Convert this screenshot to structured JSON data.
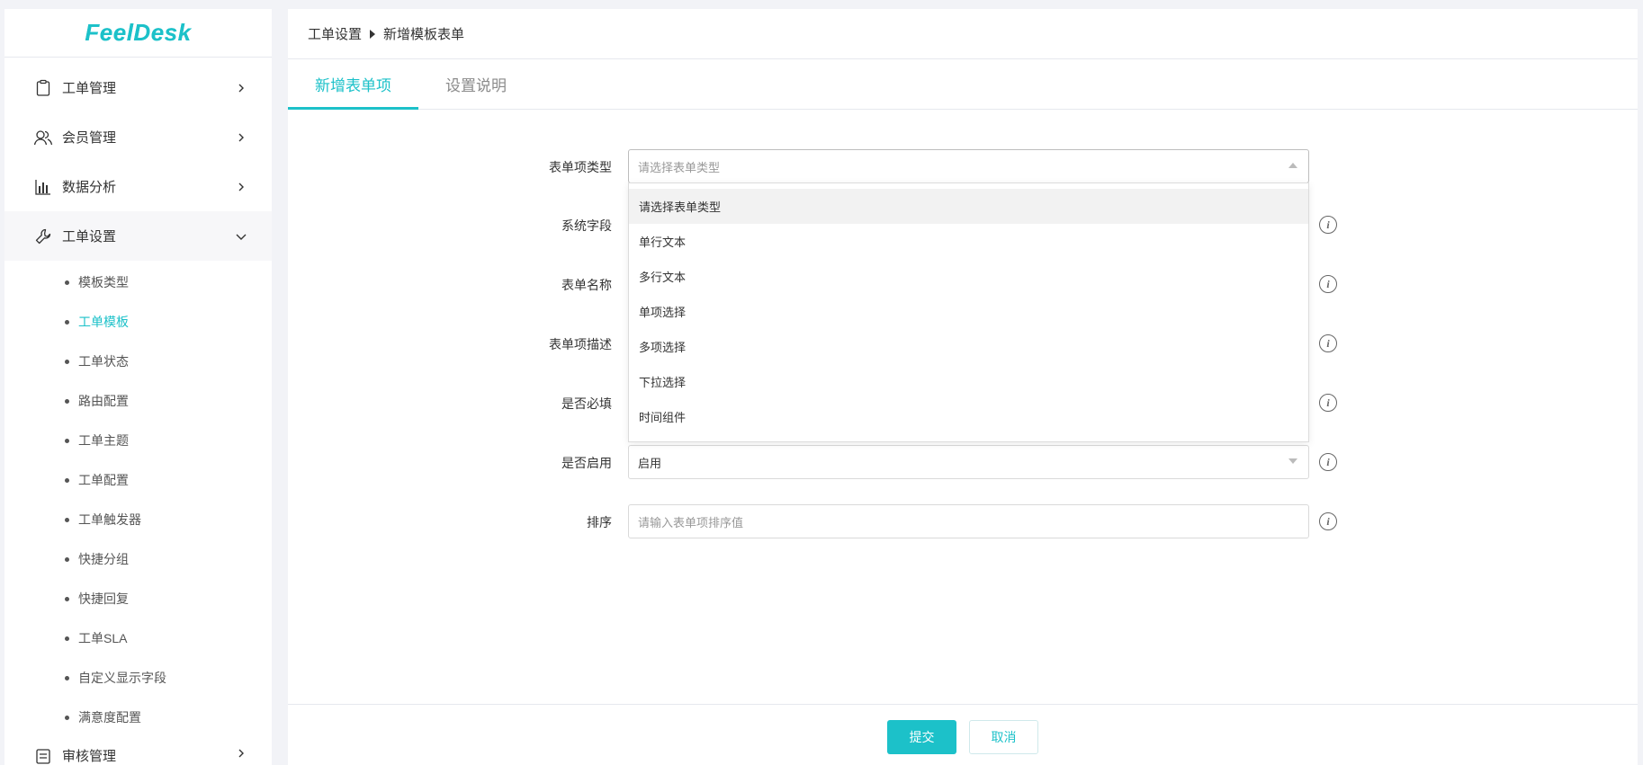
{
  "brand": {
    "logo_text": "FeelDesk",
    "accent": "#1cc1c9"
  },
  "sidebar": {
    "items": [
      {
        "label": "工单管理",
        "icon": "clipboard-icon",
        "expanded": false
      },
      {
        "label": "会员管理",
        "icon": "users-icon",
        "expanded": false
      },
      {
        "label": "数据分析",
        "icon": "bar-chart-icon",
        "expanded": false
      },
      {
        "label": "工单设置",
        "icon": "wrench-icon",
        "expanded": true
      }
    ],
    "sub_items": [
      {
        "label": "模板类型",
        "active": false
      },
      {
        "label": "工单模板",
        "active": true
      },
      {
        "label": "工单状态",
        "active": false
      },
      {
        "label": "路由配置",
        "active": false
      },
      {
        "label": "工单主题",
        "active": false
      },
      {
        "label": "工单配置",
        "active": false
      },
      {
        "label": "工单触发器",
        "active": false
      },
      {
        "label": "快捷分组",
        "active": false
      },
      {
        "label": "快捷回复",
        "active": false
      },
      {
        "label": "工单SLA",
        "active": false
      },
      {
        "label": "自定义显示字段",
        "active": false
      },
      {
        "label": "满意度配置",
        "active": false
      }
    ],
    "bottom_item": {
      "label": "审核管理"
    }
  },
  "breadcrumb": {
    "parent": "工单设置",
    "current": "新增模板表单"
  },
  "tabs": [
    {
      "label": "新增表单项",
      "active": true
    },
    {
      "label": "设置说明",
      "active": false
    }
  ],
  "form": {
    "fields": [
      {
        "label": "表单项类型",
        "placeholder": "请选择表单类型",
        "value": "",
        "type": "select",
        "open": true
      },
      {
        "label": "系统字段",
        "placeholder": "",
        "value": "",
        "type": "select"
      },
      {
        "label": "表单名称",
        "placeholder": "",
        "value": "",
        "type": "input"
      },
      {
        "label": "表单项描述",
        "placeholder": "",
        "value": "",
        "type": "input"
      },
      {
        "label": "是否必填",
        "placeholder": "",
        "value": "",
        "type": "select"
      },
      {
        "label": "是否启用",
        "placeholder": "",
        "value": "启用",
        "type": "select"
      },
      {
        "label": "排序",
        "placeholder": "请输入表单项排序值",
        "value": "",
        "type": "input"
      }
    ],
    "dropdown_options": [
      {
        "label": "请选择表单类型",
        "active": true
      },
      {
        "label": "单行文本",
        "active": false
      },
      {
        "label": "多行文本",
        "active": false
      },
      {
        "label": "单项选择",
        "active": false
      },
      {
        "label": "多项选择",
        "active": false
      },
      {
        "label": "下拉选择",
        "active": false
      },
      {
        "label": "时间组件",
        "active": false
      }
    ]
  },
  "footer": {
    "submit_label": "提交",
    "cancel_label": "取消"
  }
}
